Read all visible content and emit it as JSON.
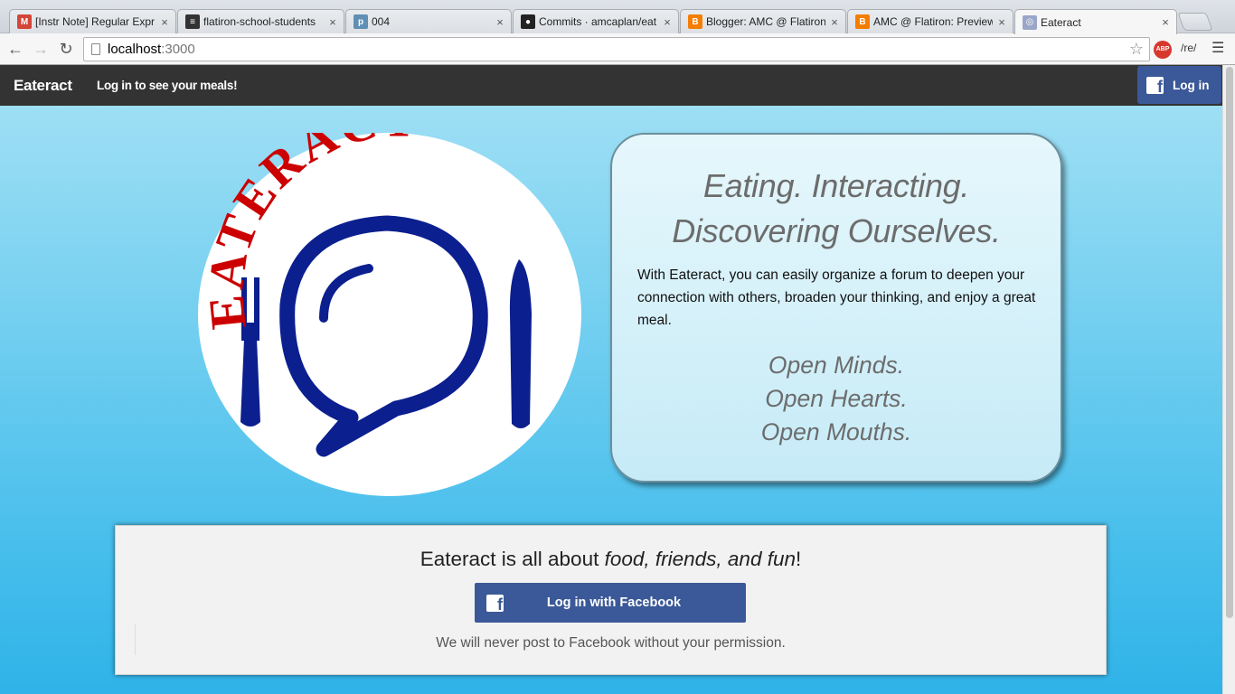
{
  "browser": {
    "tabs": [
      {
        "title": "[Instr Note] Regular Expr",
        "icon": "gmail-icon",
        "color": "#d44638",
        "glyph": "M",
        "active": false
      },
      {
        "title": "flatiron-school-students",
        "icon": "chat-icon",
        "color": "#333333",
        "glyph": "≡",
        "active": false
      },
      {
        "title": "004",
        "icon": "p-icon",
        "color": "#5f8fb5",
        "glyph": "p",
        "active": false
      },
      {
        "title": "Commits · amcaplan/eat",
        "icon": "github-icon",
        "color": "#222222",
        "glyph": "●",
        "active": false
      },
      {
        "title": "Blogger: AMC @ Flatiron",
        "icon": "blogger-icon",
        "color": "#f57d00",
        "glyph": "B",
        "active": false
      },
      {
        "title": "AMC @ Flatiron: Preview",
        "icon": "blogger-icon",
        "color": "#f57d00",
        "glyph": "B",
        "active": false
      },
      {
        "title": "Eateract",
        "icon": "eateract-favicon",
        "color": "#9aa6c8",
        "glyph": "◎",
        "active": true
      }
    ],
    "url_host": "localhost",
    "url_port": ":3000",
    "extension_label": "/re/",
    "abp_label": "ABP"
  },
  "navbar": {
    "brand": "Eateract",
    "message": "Log in to see your meals!",
    "login_label": "Log in"
  },
  "logo": {
    "text": "EATERACT",
    "text_color": "#cc0000",
    "plate_color": "#0b1f8f"
  },
  "tagline": {
    "line1": "Eating. Interacting.",
    "line2": "Discovering Ourselves.",
    "description": "With Eateract, you can easily organize a forum to deepen your connection with others, broaden your thinking, and enjoy a great meal.",
    "open1": "Open Minds.",
    "open2": "Open Hearts.",
    "open3": "Open Mouths."
  },
  "login_panel": {
    "about_prefix": "Eateract is all about ",
    "about_emphasis": "food, friends, and fun",
    "about_suffix": "!",
    "facebook_button": "Log in with Facebook",
    "fine_print": "We will never post to Facebook without your permission."
  },
  "colors": {
    "facebook_blue": "#3b5998",
    "navbar_bg": "#333333",
    "sky_top": "#a6e2f5",
    "sky_bottom": "#2fb3e8"
  }
}
